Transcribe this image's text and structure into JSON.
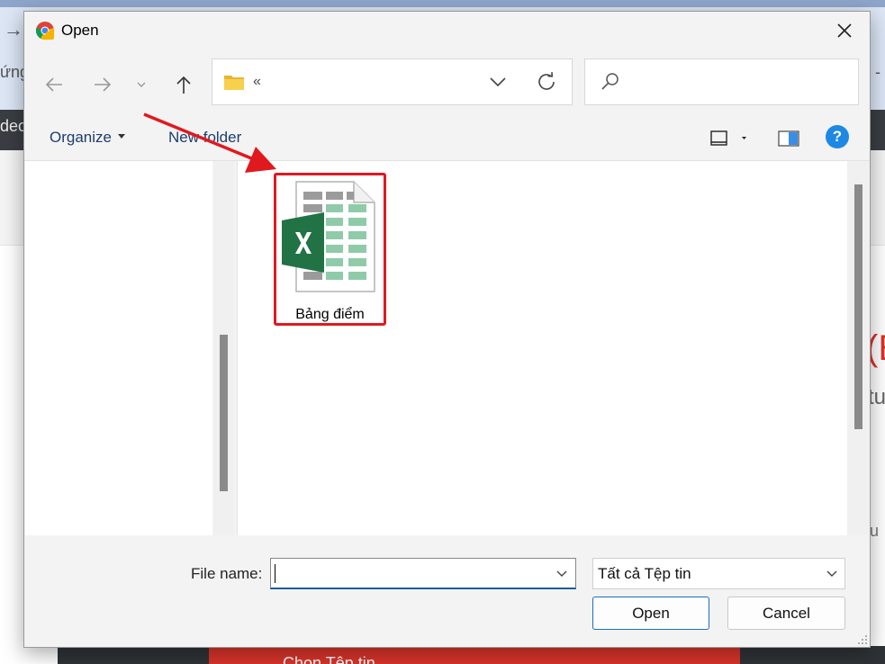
{
  "background": {
    "fragment_1": "ứng",
    "fragment_2": "deo",
    "fragment_3": "s -",
    "fragment_4": "(E",
    "fragment_5": "tu",
    "fragment_6": "u",
    "button_text": "Chọn Tệp tin"
  },
  "dialog": {
    "title": "Open",
    "address": {
      "text": "«"
    },
    "search": {
      "placeholder": ""
    },
    "toolbar": {
      "organize_label": "Organize",
      "new_folder_label": "New folder",
      "help_label": "?"
    },
    "files": [
      {
        "name": "Bảng điểm",
        "icon": "excel-file-icon",
        "selected": true
      }
    ],
    "footer": {
      "file_name_label": "File name:",
      "file_name_value": "",
      "file_type_value": "Tất cả Tệp tin",
      "open_label": "Open",
      "cancel_label": "Cancel"
    }
  },
  "colors": {
    "accent": "#1a6fc2",
    "highlight": "#e0191f",
    "excel_green": "#217346",
    "help": "#1e88e5"
  }
}
